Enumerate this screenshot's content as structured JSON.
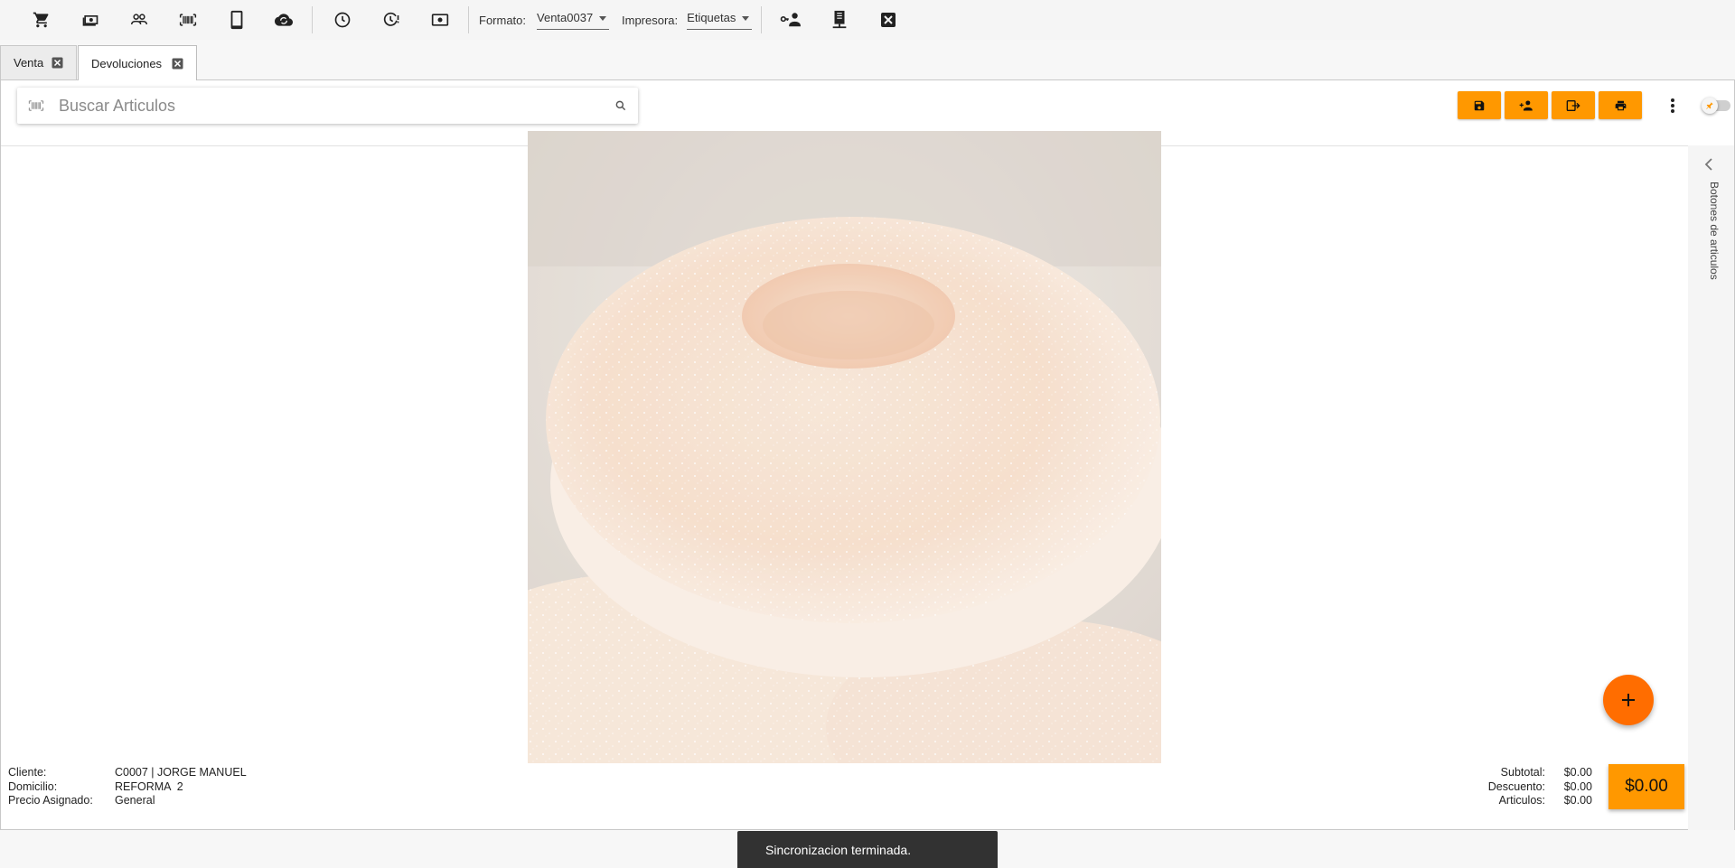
{
  "toolbar": {
    "formato_label": "Formato:",
    "formato_value": "Venta0037",
    "impresora_label": "Impresora:",
    "impresora_value": "Etiquetas"
  },
  "tabs": [
    {
      "label": "Venta",
      "active": false
    },
    {
      "label": "Devoluciones",
      "active": true
    }
  ],
  "search": {
    "placeholder": "Buscar Articulos"
  },
  "side_panel": {
    "label": "Botones de articulos"
  },
  "client": {
    "cliente_label": "Cliente:",
    "cliente_value": "C0007 | JORGE MANUEL",
    "domicilio_label": "Domicilio:",
    "domicilio_value": "REFORMA  2",
    "precio_label": "Precio Asignado:",
    "precio_value": "General"
  },
  "totals": {
    "subtotal_label": "Subtotal:",
    "subtotal_value": "$0.00",
    "descuento_label": "Descuento:",
    "descuento_value": "$0.00",
    "articulos_label": "Articulos:",
    "articulos_value": "$0.00",
    "total": "$0.00"
  },
  "snackbar": "Sincronizacion terminada.",
  "colors": {
    "accent": "#ff9800",
    "fab": "#ff6d00",
    "snackbar_bg": "#323232"
  },
  "icons": [
    "cart-icon",
    "cash-icon",
    "people-icon",
    "barcode-icon",
    "tablet-icon",
    "cloud-sync-icon",
    "clock-icon",
    "clock-alert-icon",
    "money-icon",
    "user-key-icon",
    "server-icon",
    "close-box-icon"
  ]
}
